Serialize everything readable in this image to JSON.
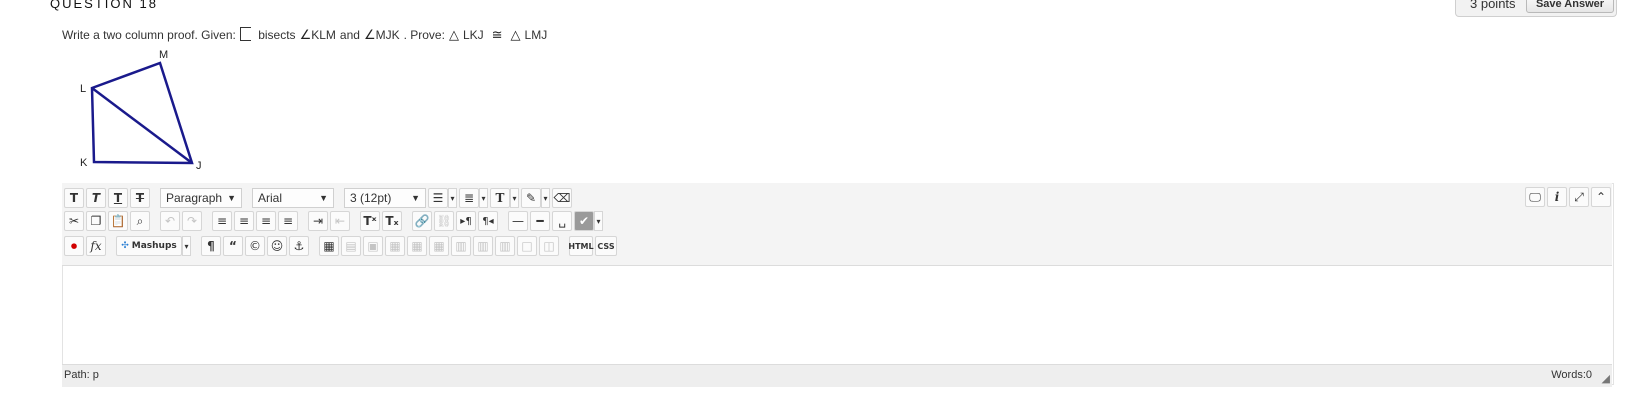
{
  "question": {
    "title": "QUESTION 18",
    "points": "3 points",
    "save_label": "Save Answer"
  },
  "prompt": {
    "lead": "Write a two column proof. Given:",
    "given_segment": "LJ",
    "bisects": "bisects",
    "angle1": "KLM",
    "and": "and",
    "angle2": "MJK",
    "prove_lead": ". Prove:",
    "triangle1": "LKJ",
    "congruent": "≅",
    "triangle2": "LMJ",
    "angle_symbol": "∠",
    "triangle_symbol": "△"
  },
  "figure": {
    "labels": [
      "M",
      "L",
      "K",
      "J"
    ],
    "stroke_color": "#1a1a8c"
  },
  "editor": {
    "block_format": "Paragraph",
    "font_family": "Arial",
    "font_size": "3 (12pt)",
    "mashups_label": "Mashups",
    "html_label": "HTML",
    "css_label": "CSS",
    "path_label": "Path: p",
    "words_label": "Words:0"
  },
  "icons": {
    "text_format": [
      "bold-icon",
      "italic-icon",
      "underline-icon",
      "strikethrough-icon"
    ],
    "row2": [
      "cut-icon",
      "copy-icon",
      "paste-icon",
      "find-icon",
      "undo-icon",
      "redo-icon",
      "align-left-icon",
      "align-center-icon",
      "align-right-icon",
      "align-justify-icon",
      "indent-icon",
      "outdent-icon",
      "superscript-icon",
      "subscript-icon",
      "link-icon",
      "unlink-icon",
      "ltr-icon",
      "rtl-icon",
      "hr-icon",
      "thick-hr-icon",
      "nbsp-icon",
      "spellcheck-icon"
    ],
    "row3": [
      "youtube-icon",
      "formula-icon",
      "mashups-icon",
      "pilcrow-icon",
      "blockquote-icon",
      "copyright-icon",
      "emoticon-icon",
      "anchor-icon",
      "table-icon"
    ]
  }
}
